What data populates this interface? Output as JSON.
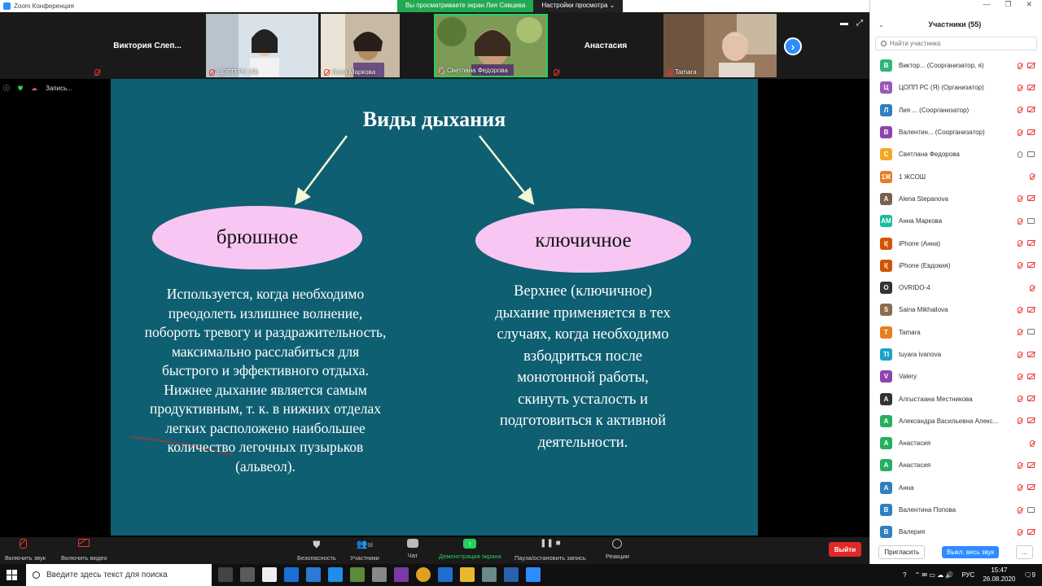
{
  "window": {
    "title": "Zoom Конференция"
  },
  "share_banner": {
    "status": "Вы просматриваете экран Лия Сивцева",
    "view_settings": "Настройки просмотра"
  },
  "video_strip": {
    "tiles": [
      {
        "name": "Виктория  Слеп...",
        "has_video": false
      },
      {
        "name": "ЦОПП РС (Я)",
        "has_video": true,
        "bg": "#cfd8de"
      },
      {
        "name": "Анна Маркова",
        "has_video": true,
        "bg": "#b9a58c"
      },
      {
        "name": "Светлана Федорова",
        "has_video": true,
        "bg": "#7c8f52"
      },
      {
        "name": "Анастасия",
        "has_video": false
      },
      {
        "name": "Tamara",
        "has_video": true,
        "bg": "#8d6b50"
      }
    ]
  },
  "recording": {
    "label": "Запись..."
  },
  "slide": {
    "title": "Виды дыхания",
    "left_label": "брюшное",
    "right_label": "ключичное",
    "left_text": "Используется, когда  необходимо преодолеть излишнее волнение, побороть тревогу и раздражительность, максимально расслабиться для быстрого и эффективного отдыха.  Нижнее дыхание является самым продуктивным, т. к. в  нижних отделах легких расположено наибольшее количество легочных пузырьков (альвеол).",
    "right_text": "Верхнее (ключичное) дыхание применяется в тех случаях, когда необходимо взбодриться после монотонной работы, скинуть усталость и подготовиться к активной деятельности."
  },
  "participants": {
    "title": "Участники (55)",
    "search_placeholder": "Найти участника",
    "items": [
      {
        "initial": "В",
        "color": "#2fb67b",
        "name": "Виктор... (Соорганизатор, я)",
        "mic": "off",
        "cam": "off"
      },
      {
        "initial": "Ц",
        "color": "#9b59b6",
        "name": "ЦОПП РС (Я) (Организатор)",
        "mic": "off",
        "cam": "off"
      },
      {
        "initial": "Л",
        "color": "#2f7fbf",
        "name": "Лия ...  (Соорганизатор)",
        "mic": "off",
        "cam": "off"
      },
      {
        "initial": "В",
        "color": "#8e44ad",
        "name": "Валентин... (Соорганизатор)",
        "mic": "off",
        "cam": "off"
      },
      {
        "initial": "С",
        "color": "#f5a623",
        "name": "Светлана Федорова",
        "mic": "on",
        "cam": "on"
      },
      {
        "initial": "1Ж",
        "color": "#e67e22",
        "name": "1 ЖСОШ",
        "mic": "off",
        "cam": "none"
      },
      {
        "initial": "A",
        "color": "#7a6050",
        "name": "Alena Stepanova",
        "mic": "off",
        "cam": "off"
      },
      {
        "initial": "АМ",
        "color": "#1abc9c",
        "name": "Анна Маркова",
        "mic": "off",
        "cam": "on"
      },
      {
        "initial": "I(",
        "color": "#d35400",
        "name": "iPhone (Анна)",
        "mic": "off",
        "cam": "off"
      },
      {
        "initial": "I(",
        "color": "#d35400",
        "name": "iPhone (Евдокия)",
        "mic": "off",
        "cam": "off"
      },
      {
        "initial": "O",
        "color": "#333333",
        "name": "OVRIDO-4",
        "mic": "off",
        "cam": "none"
      },
      {
        "initial": "S",
        "color": "#8a6d4a",
        "name": "Saina Mikhailova",
        "mic": "off",
        "cam": "off"
      },
      {
        "initial": "T",
        "color": "#e67e22",
        "name": "Tamara",
        "mic": "off",
        "cam": "on"
      },
      {
        "initial": "TI",
        "color": "#1aa3c8",
        "name": "tuyara ivanova",
        "mic": "off",
        "cam": "off"
      },
      {
        "initial": "V",
        "color": "#8e44ad",
        "name": "Valery",
        "mic": "off",
        "cam": "off"
      },
      {
        "initial": "А",
        "color": "#333333",
        "name": "Алгыстаана Местникова",
        "mic": "off",
        "cam": "off"
      },
      {
        "initial": "А",
        "color": "#27ae60",
        "name": "Александра Васильевна Алекс...",
        "mic": "off",
        "cam": "off"
      },
      {
        "initial": "А",
        "color": "#27ae60",
        "name": "Анастасия",
        "mic": "off",
        "cam": "none"
      },
      {
        "initial": "А",
        "color": "#27ae60",
        "name": "Анастасия",
        "mic": "off",
        "cam": "off"
      },
      {
        "initial": "А",
        "color": "#2f7fbf",
        "name": "Анна",
        "mic": "off",
        "cam": "off"
      },
      {
        "initial": "В",
        "color": "#2f7fbf",
        "name": "Валентина Попова",
        "mic": "off",
        "cam": "on"
      },
      {
        "initial": "В",
        "color": "#2f7fbf",
        "name": "Валерия",
        "mic": "off",
        "cam": "off"
      }
    ],
    "invite": "Пригласить",
    "mute_all": "Выкл. весь звук",
    "more": "..."
  },
  "toolbar": {
    "mute": "Включить звук",
    "video": "Включить видео",
    "security": "Безопасность",
    "participants": "Участники",
    "participants_count": "55",
    "chat": "Чат",
    "share": "Демонстрация экрана",
    "pause_rec": "Пауза/остановить запись",
    "reactions": "Реакции",
    "leave": "Выйти"
  },
  "taskbar": {
    "search_placeholder": "Введите здесь текст для поиска",
    "lang": "РУС",
    "time": "15:47",
    "date": "26.08.2020",
    "notifications": "9"
  }
}
